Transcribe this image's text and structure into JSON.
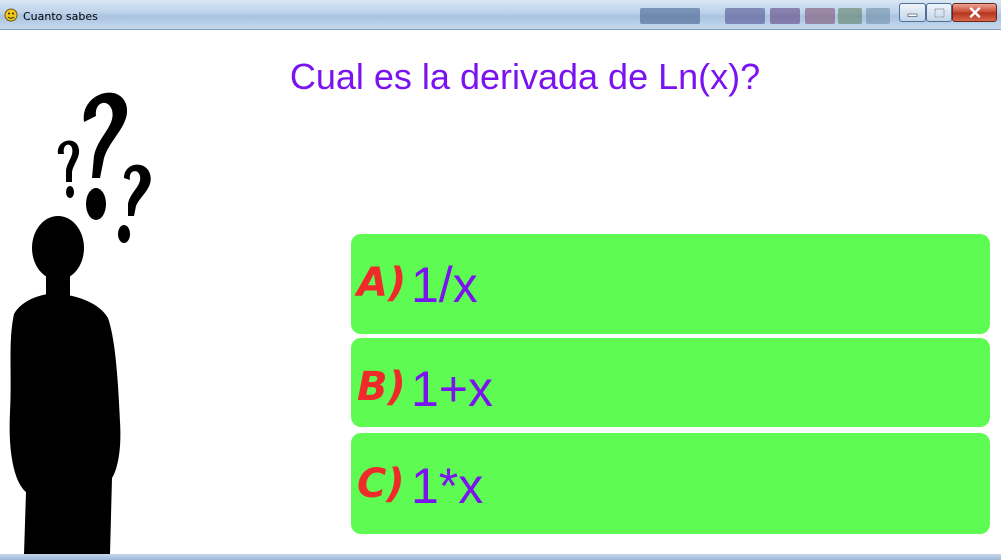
{
  "window": {
    "title": "Cuanto sabes",
    "app_icon": "pygame-snake-icon",
    "controls": {
      "minimize": "minimize-icon",
      "maximize": "maximize-icon",
      "close": "close-icon"
    }
  },
  "quiz": {
    "question": "Cual es la derivada de Ln(x)?",
    "answers": [
      {
        "letter": "A)",
        "text": "1/x"
      },
      {
        "letter": "B)",
        "text": "1+x"
      },
      {
        "letter": "C)",
        "text": "1*x"
      }
    ]
  },
  "colors": {
    "question_text": "#7a13f0",
    "answer_background": "#5efc52",
    "answer_letter": "#ee2a2a",
    "answer_text": "#7a13f0",
    "silhouette": "#000000"
  },
  "illustration": "thinking-person-silhouette-with-question-marks"
}
